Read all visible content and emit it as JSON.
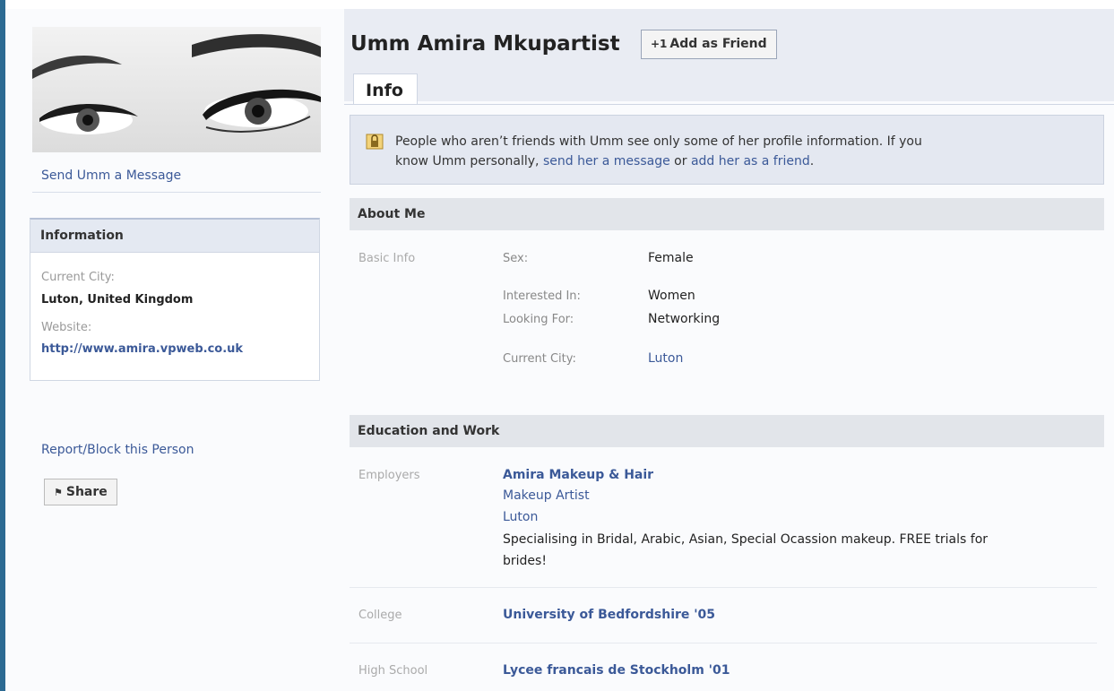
{
  "profile": {
    "name": "Umm Amira Mkupartist",
    "add_friend_label": "Add as Friend",
    "tab_info": "Info"
  },
  "sidebar": {
    "send_message": "Send Umm a Message",
    "info_box": {
      "title": "Information",
      "current_city_label": "Current City:",
      "current_city_value": "Luton, United Kingdom",
      "website_label": "Website:",
      "website_value": "http://www.amira.vpweb.co.uk"
    },
    "report_block": "Report/Block this Person",
    "share_label": "Share"
  },
  "notice": {
    "line1": "People who aren’t friends with Umm see only some of her profile information. If you",
    "line2_prefix": "know Umm personally, ",
    "send_message_link": "send her a message",
    "or_text": " or ",
    "add_friend_link": "add her as a friend",
    "end_text": "."
  },
  "about_me": {
    "heading": "About Me",
    "category": "Basic Info",
    "fields": [
      {
        "label": "Sex:",
        "value": "Female"
      },
      {
        "label": "Interested In:",
        "value": "Women"
      },
      {
        "label": "Looking For:",
        "value": "Networking"
      },
      {
        "label": "Current City:",
        "value": "Luton"
      }
    ]
  },
  "education_work": {
    "heading": "Education and Work",
    "employers_label": "Employers",
    "employer_name": "Amira Makeup & Hair",
    "employer_position": "Makeup Artist",
    "employer_location": "Luton",
    "employer_desc_line1": "Specialising in Bridal, Arabic, Asian, Special Ocassion makeup. FREE trials for",
    "employer_desc_line2": "brides!",
    "college_label": "College",
    "college_value": "University of Bedfordshire '05",
    "high_school_label": "High School",
    "high_school_value": "Lycee francais de Stockholm '01"
  },
  "icons": {
    "lock": "lock-icon",
    "add_friend": "add-friend-icon",
    "share": "share-icon"
  },
  "colors": {
    "link": "#3b5998",
    "header_band": "#e9ecf3",
    "section_header": "#e2e5ea",
    "sidebar_accent": "#2c6a92"
  }
}
